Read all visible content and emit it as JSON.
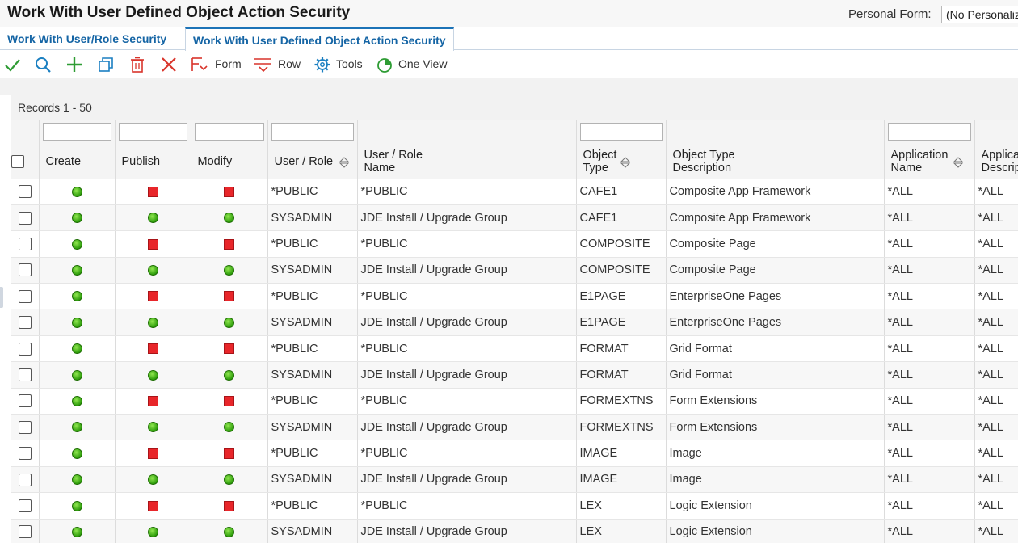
{
  "page": {
    "title": "Work With User Defined Object Action Security",
    "personal_form_label": "Personal Form:",
    "personal_form_value": "(No Personalization)"
  },
  "tabs": [
    {
      "label": "Work With User/Role Security",
      "active": false
    },
    {
      "label": "Work With User Defined Object Action Security",
      "active": true
    }
  ],
  "toolbar": {
    "icons": [
      "check-icon",
      "search-icon",
      "add-icon",
      "copy-icon",
      "delete-icon",
      "close-icon"
    ],
    "form_label": "Form",
    "row_label": "Row",
    "tools_label": "Tools",
    "one_view_label": "One View"
  },
  "grid": {
    "records_label": "Records 1 - 50",
    "columns": [
      {
        "key": "create",
        "label": "Create"
      },
      {
        "key": "publish",
        "label": "Publish"
      },
      {
        "key": "modify",
        "label": "Modify"
      },
      {
        "key": "user_role",
        "label": "User / Role"
      },
      {
        "key": "user_role_name",
        "label_line1": "User / Role",
        "label_line2": "Name"
      },
      {
        "key": "object_type",
        "label_line1": "Object",
        "label_line2": "Type"
      },
      {
        "key": "object_type_desc",
        "label_line1": "Object Type",
        "label_line2": "Description"
      },
      {
        "key": "application_name",
        "label_line1": "Application",
        "label_line2": "Name"
      },
      {
        "key": "application_desc",
        "label_line1": "Application",
        "label_line2": "Description"
      }
    ],
    "rows": [
      {
        "create": "allowed",
        "publish": "denied",
        "modify": "denied",
        "user_role": "*PUBLIC",
        "user_role_name": "*PUBLIC",
        "object_type": "CAFE1",
        "object_type_desc": "Composite App Framework",
        "application_name": "*ALL",
        "application_desc": "*ALL"
      },
      {
        "create": "allowed",
        "publish": "allowed",
        "modify": "allowed",
        "user_role": "SYSADMIN",
        "user_role_name": "JDE Install / Upgrade Group",
        "object_type": "CAFE1",
        "object_type_desc": "Composite App Framework",
        "application_name": "*ALL",
        "application_desc": "*ALL"
      },
      {
        "create": "allowed",
        "publish": "denied",
        "modify": "denied",
        "user_role": "*PUBLIC",
        "user_role_name": "*PUBLIC",
        "object_type": "COMPOSITE",
        "object_type_desc": "Composite Page",
        "application_name": "*ALL",
        "application_desc": "*ALL"
      },
      {
        "create": "allowed",
        "publish": "allowed",
        "modify": "allowed",
        "user_role": "SYSADMIN",
        "user_role_name": "JDE Install / Upgrade Group",
        "object_type": "COMPOSITE",
        "object_type_desc": "Composite Page",
        "application_name": "*ALL",
        "application_desc": "*ALL"
      },
      {
        "create": "allowed",
        "publish": "denied",
        "modify": "denied",
        "user_role": "*PUBLIC",
        "user_role_name": "*PUBLIC",
        "object_type": "E1PAGE",
        "object_type_desc": "EnterpriseOne Pages",
        "application_name": "*ALL",
        "application_desc": "*ALL"
      },
      {
        "create": "allowed",
        "publish": "allowed",
        "modify": "allowed",
        "user_role": "SYSADMIN",
        "user_role_name": "JDE Install / Upgrade Group",
        "object_type": "E1PAGE",
        "object_type_desc": "EnterpriseOne Pages",
        "application_name": "*ALL",
        "application_desc": "*ALL"
      },
      {
        "create": "allowed",
        "publish": "denied",
        "modify": "denied",
        "user_role": "*PUBLIC",
        "user_role_name": "*PUBLIC",
        "object_type": "FORMAT",
        "object_type_desc": "Grid Format",
        "application_name": "*ALL",
        "application_desc": "*ALL"
      },
      {
        "create": "allowed",
        "publish": "allowed",
        "modify": "allowed",
        "user_role": "SYSADMIN",
        "user_role_name": "JDE Install / Upgrade Group",
        "object_type": "FORMAT",
        "object_type_desc": "Grid Format",
        "application_name": "*ALL",
        "application_desc": "*ALL"
      },
      {
        "create": "allowed",
        "publish": "denied",
        "modify": "denied",
        "user_role": "*PUBLIC",
        "user_role_name": "*PUBLIC",
        "object_type": "FORMEXTNS",
        "object_type_desc": "Form Extensions",
        "application_name": "*ALL",
        "application_desc": "*ALL"
      },
      {
        "create": "allowed",
        "publish": "allowed",
        "modify": "allowed",
        "user_role": "SYSADMIN",
        "user_role_name": "JDE Install / Upgrade Group",
        "object_type": "FORMEXTNS",
        "object_type_desc": "Form Extensions",
        "application_name": "*ALL",
        "application_desc": "*ALL"
      },
      {
        "create": "allowed",
        "publish": "denied",
        "modify": "denied",
        "user_role": "*PUBLIC",
        "user_role_name": "*PUBLIC",
        "object_type": "IMAGE",
        "object_type_desc": "Image",
        "application_name": "*ALL",
        "application_desc": "*ALL"
      },
      {
        "create": "allowed",
        "publish": "allowed",
        "modify": "allowed",
        "user_role": "SYSADMIN",
        "user_role_name": "JDE Install / Upgrade Group",
        "object_type": "IMAGE",
        "object_type_desc": "Image",
        "application_name": "*ALL",
        "application_desc": "*ALL"
      },
      {
        "create": "allowed",
        "publish": "denied",
        "modify": "denied",
        "user_role": "*PUBLIC",
        "user_role_name": "*PUBLIC",
        "object_type": "LEX",
        "object_type_desc": "Logic Extension",
        "application_name": "*ALL",
        "application_desc": "*ALL"
      },
      {
        "create": "allowed",
        "publish": "allowed",
        "modify": "allowed",
        "user_role": "SYSADMIN",
        "user_role_name": "JDE Install / Upgrade Group",
        "object_type": "LEX",
        "object_type_desc": "Logic Extension",
        "application_name": "*ALL",
        "application_desc": "*ALL"
      }
    ]
  },
  "colors": {
    "accent": "#1565a5",
    "allowed": "#2f9e0c",
    "denied": "#e8262a"
  }
}
